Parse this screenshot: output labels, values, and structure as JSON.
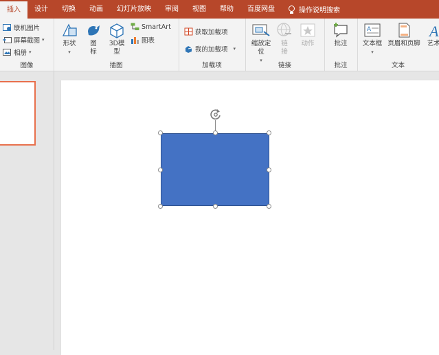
{
  "tabs": [
    {
      "label": "插入",
      "active": true
    },
    {
      "label": "设计"
    },
    {
      "label": "切换"
    },
    {
      "label": "动画"
    },
    {
      "label": "幻灯片放映"
    },
    {
      "label": "审阅"
    },
    {
      "label": "视图"
    },
    {
      "label": "帮助"
    },
    {
      "label": "百度网盘"
    }
  ],
  "tell_me": "操作说明搜索",
  "ribbon": {
    "images": {
      "label": "图像",
      "online_pictures": "联机图片",
      "screenshot": "屏幕截图",
      "album": "相册"
    },
    "illustrations": {
      "label": "插图",
      "shapes": "形状",
      "icons": "图标",
      "3d_models": "3D模型",
      "smartart": "SmartArt",
      "chart": "图表"
    },
    "addins": {
      "label": "加载项",
      "get_addins": "获取加载项",
      "my_addins": "我的加载项"
    },
    "links": {
      "label": "链接",
      "zoom": "缩放定位",
      "link": "链接",
      "action": "动作"
    },
    "comments": {
      "label": "批注",
      "comment": "批注"
    },
    "text": {
      "label": "文本",
      "textbox": "文本框",
      "header_footer": "页眉和页脚",
      "wordart": "艺术字"
    }
  },
  "colors": {
    "accent": "#b7472a",
    "shape_fill": "#4472c4",
    "thumb_border": "#e8704c"
  }
}
